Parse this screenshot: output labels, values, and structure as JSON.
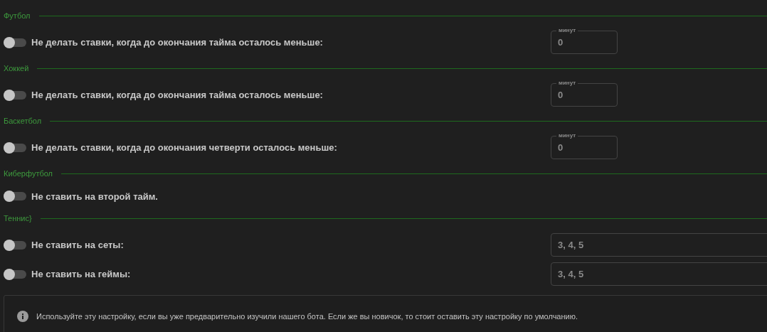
{
  "sections": [
    {
      "title": "Футбол",
      "rows": [
        {
          "label": "Не делать ставки, когда до окончания тайма осталось меньше:",
          "on": false,
          "field": {
            "kind": "minutes",
            "label": "минут",
            "value": "0"
          }
        }
      ]
    },
    {
      "title": "Хоккей",
      "rows": [
        {
          "label": "Не делать ставки, когда до окончания тайма осталось меньше:",
          "on": false,
          "field": {
            "kind": "minutes",
            "label": "минут",
            "value": "0"
          }
        }
      ]
    },
    {
      "title": "Баскетбол",
      "rows": [
        {
          "label": "Не делать ставки, когда до окончания четверти осталось меньше:",
          "on": false,
          "field": {
            "kind": "minutes",
            "label": "минут",
            "value": "0"
          }
        }
      ]
    },
    {
      "title": "Киберфутбол",
      "rows": [
        {
          "label": "Не ставить на второй тайм.",
          "on": false
        }
      ]
    },
    {
      "title": "Теннис}",
      "rows": [
        {
          "label": "Не ставить на сеты:",
          "on": false,
          "field": {
            "kind": "text",
            "value": "3, 4, 5"
          }
        },
        {
          "label": "Не ставить на геймы:",
          "on": false,
          "field": {
            "kind": "text",
            "value": "3, 4, 5"
          }
        }
      ]
    }
  ],
  "info": "Используйте эту настройку, если вы уже предварительно изучили нашего бота. Если же вы новичок, то стоит оставить эту настройку по умолчанию."
}
